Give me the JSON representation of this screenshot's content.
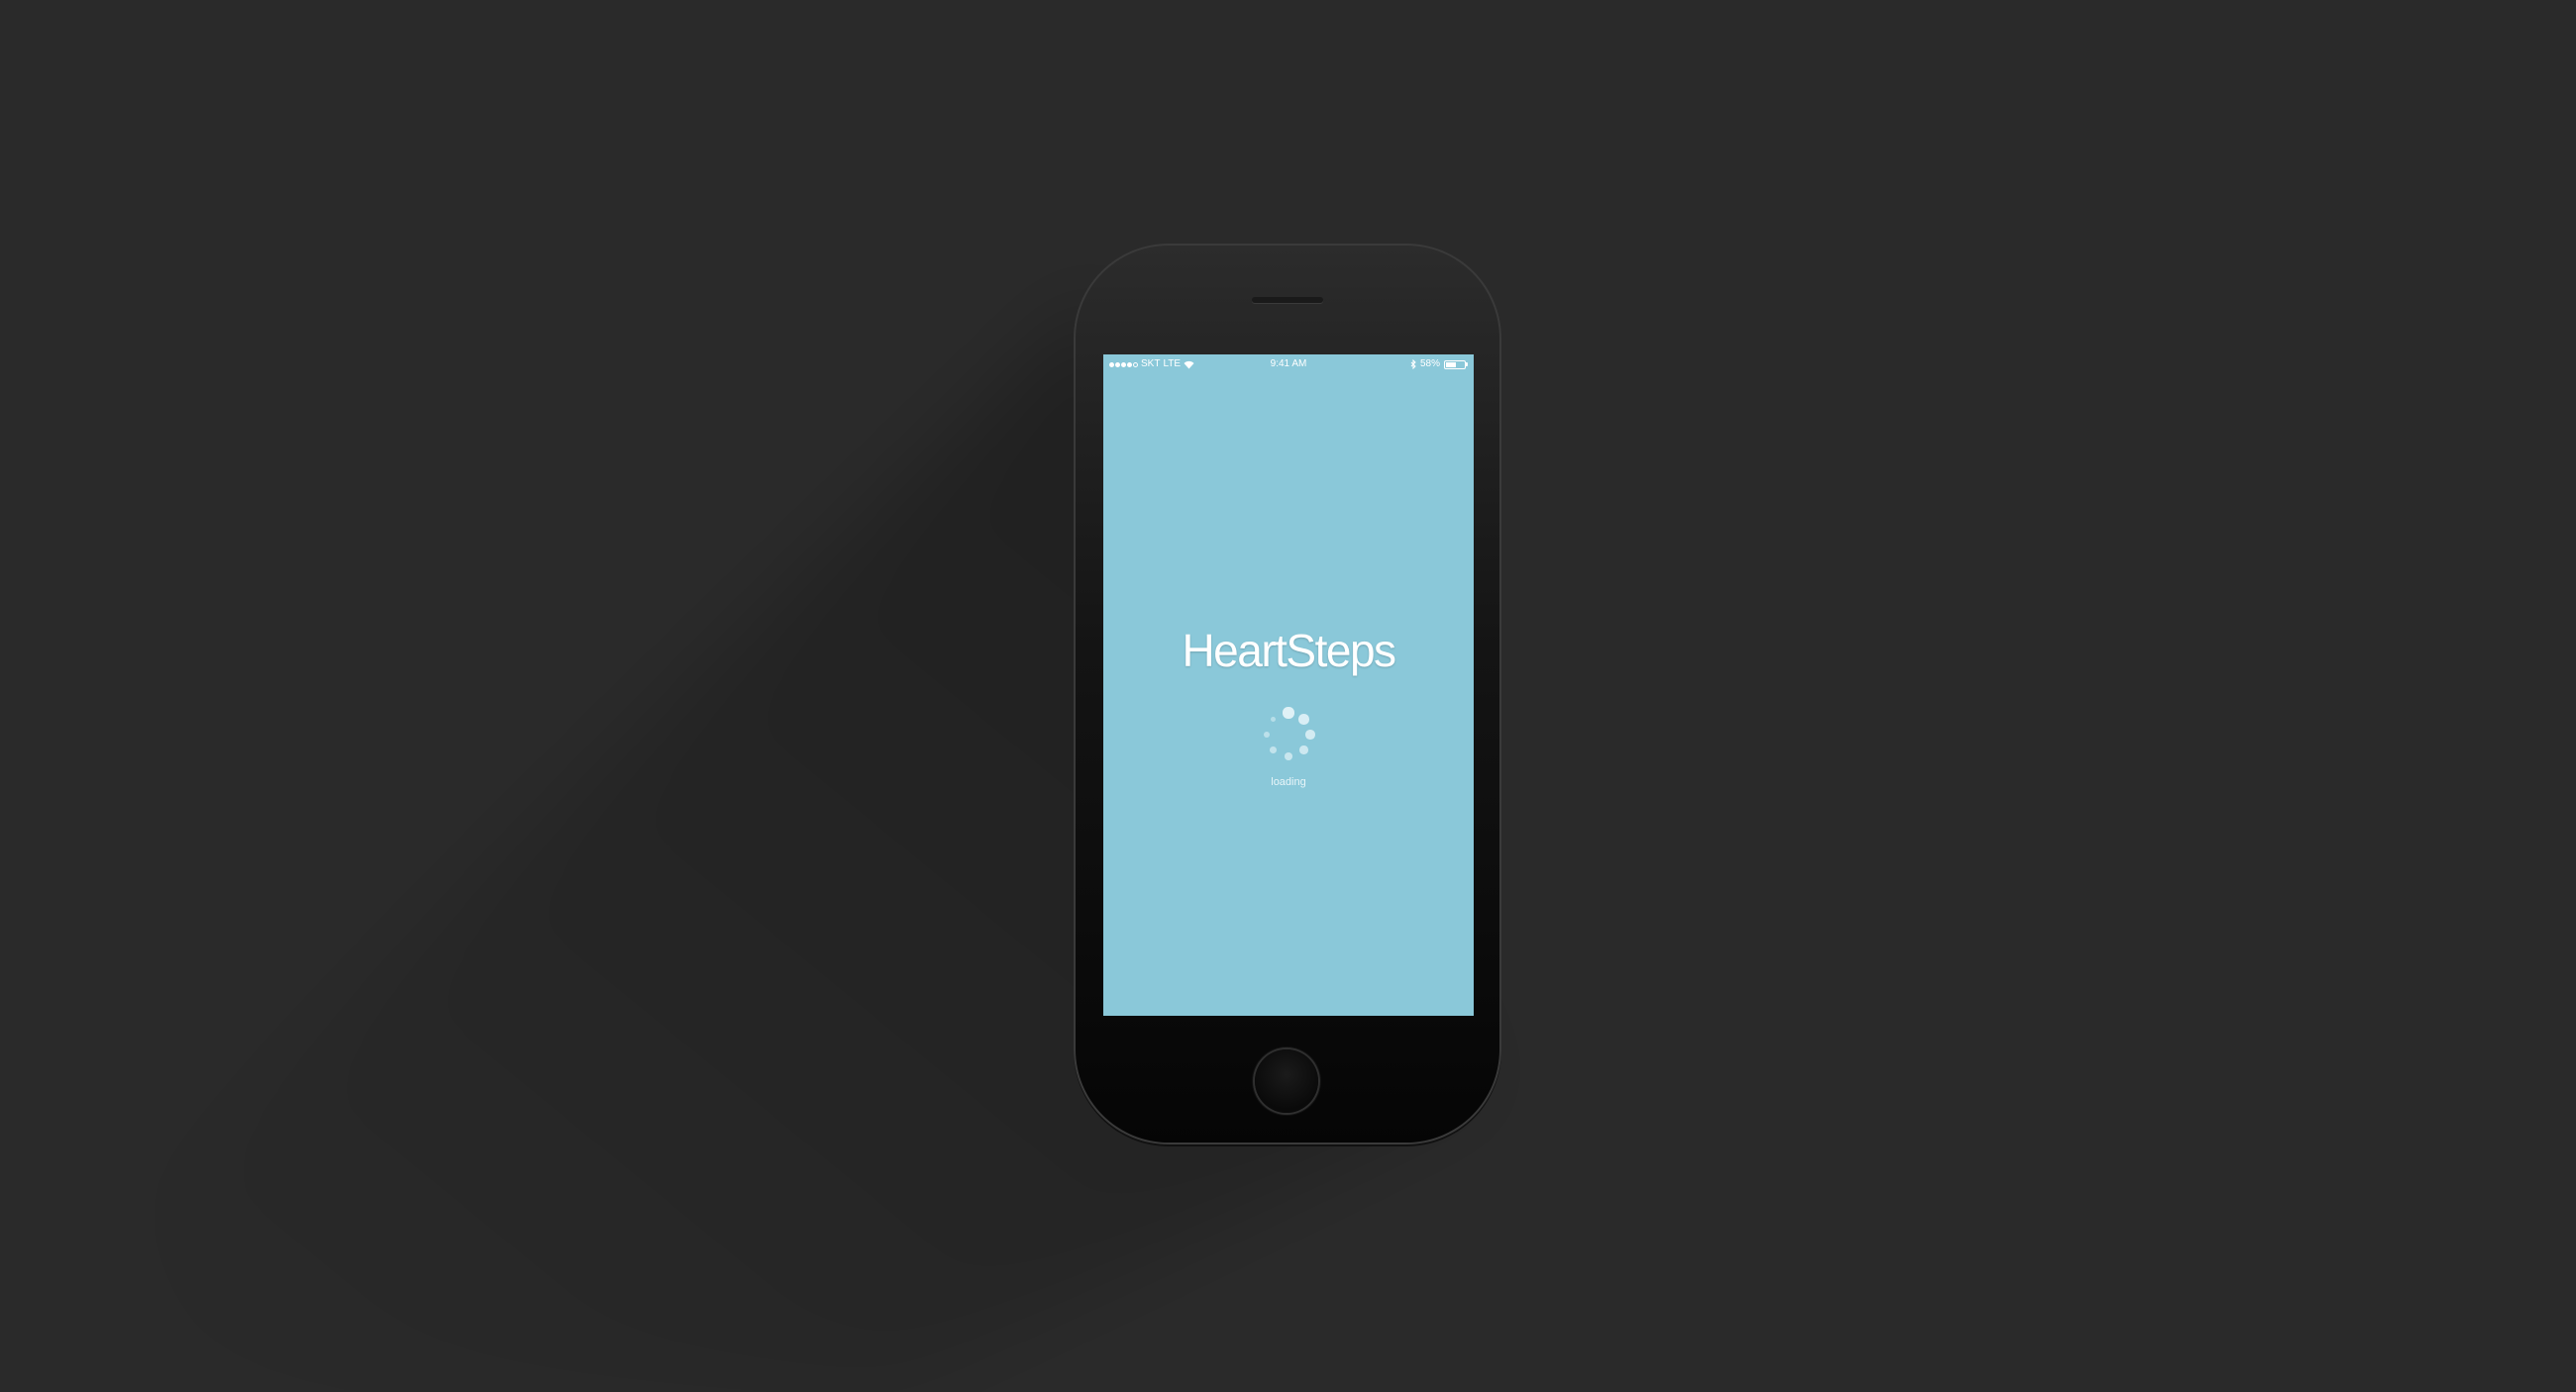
{
  "status_bar": {
    "carrier": "SKT",
    "network": "LTE",
    "time": "9:41 AM",
    "battery_percent": "58%",
    "battery_level": 0.58
  },
  "app": {
    "title": "HeartSteps",
    "loading_text": "loading"
  },
  "colors": {
    "background": "#2a2a2a",
    "screen": "#8ac8d9",
    "text": "#ffffff"
  }
}
